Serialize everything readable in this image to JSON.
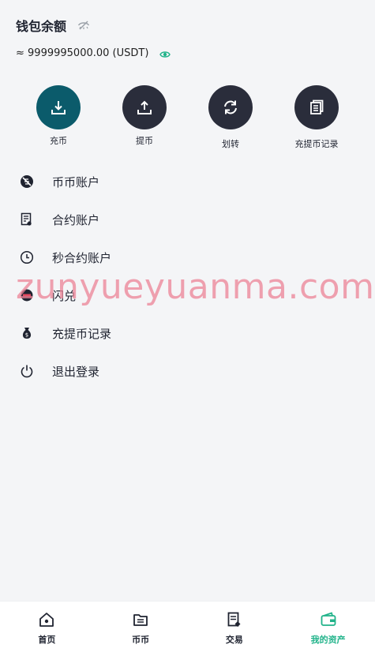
{
  "header": {
    "title": "钱包余额",
    "hide_icon": "eye-slash-icon"
  },
  "balance": {
    "text": "≈ 9999995000.00 (USDT)",
    "eye_icon": "eye-icon"
  },
  "actions": [
    {
      "label": "充币",
      "icon": "download-icon"
    },
    {
      "label": "提币",
      "icon": "upload-icon"
    },
    {
      "label": "划转",
      "icon": "refresh-icon"
    },
    {
      "label": "充提币记录",
      "icon": "document-icon"
    }
  ],
  "menu": [
    {
      "label": "币币账户",
      "icon": "coin-icon"
    },
    {
      "label": "合约账户",
      "icon": "contract-icon"
    },
    {
      "label": "秒合约账户",
      "icon": "clock-icon"
    },
    {
      "label": "闪兑",
      "icon": "exchange-icon"
    },
    {
      "label": "充提币记录",
      "icon": "money-bag-icon"
    },
    {
      "label": "退出登录",
      "icon": "power-icon"
    }
  ],
  "watermark": "zunyueyuanma.com",
  "tabbar": [
    {
      "label": "首页",
      "icon": "home-icon"
    },
    {
      "label": "币币",
      "icon": "folder-icon"
    },
    {
      "label": "交易",
      "icon": "trade-icon"
    },
    {
      "label": "我的资产",
      "icon": "wallet-icon",
      "active": true
    }
  ],
  "colors": {
    "primary_button": "#0b5b6b",
    "dark_button": "#2a2d3b",
    "accent": "#21b38a",
    "background": "#f4f5f7"
  }
}
